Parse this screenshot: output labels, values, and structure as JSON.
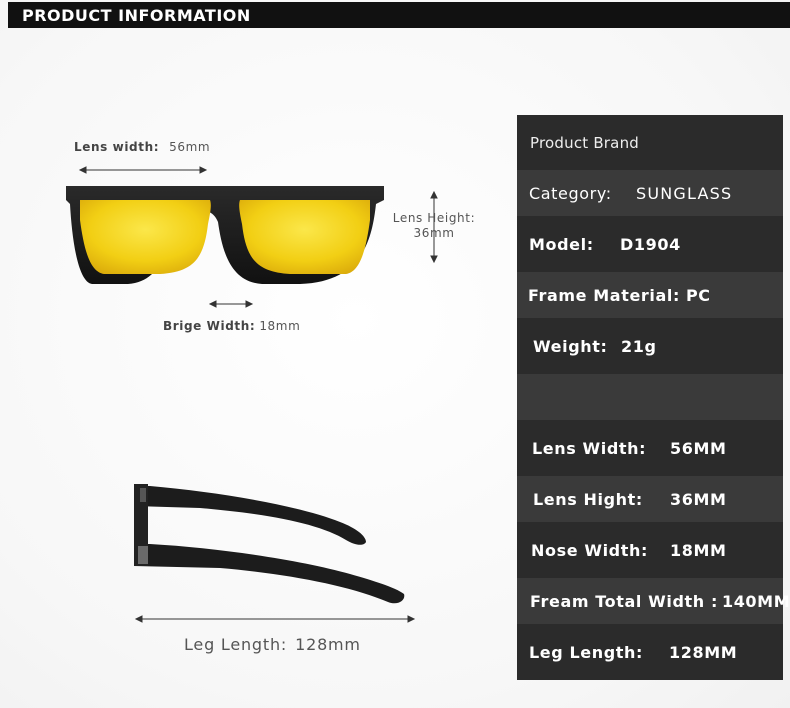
{
  "header": {
    "title": "PRODUCT INFORMATION"
  },
  "dimensions": {
    "lens_width": {
      "label": "Lens width:",
      "value": "56mm"
    },
    "lens_height": {
      "label": "Lens Height:",
      "value": "36mm"
    },
    "bridge_width": {
      "label": "Brige Width:",
      "value": "18mm"
    },
    "leg_length": {
      "label": "Leg Length:",
      "value": "128mm"
    }
  },
  "specs": [
    {
      "key": "Product Brand",
      "value": ""
    },
    {
      "key": "Category:",
      "value": "SUNGLASS"
    },
    {
      "key": "Model:",
      "value": "D1904"
    },
    {
      "key": "Frame Material:",
      "value": "PC"
    },
    {
      "key": "Weight:",
      "value": "21g"
    },
    {
      "key": "",
      "value": ""
    },
    {
      "key": "Lens Width:",
      "value": "56MM"
    },
    {
      "key": "Lens Hight:",
      "value": "36MM"
    },
    {
      "key": "Nose Width:",
      "value": "18MM"
    },
    {
      "key": "Fream Total Width :",
      "value": "140MM"
    },
    {
      "key": "Leg Length:",
      "value": "128MM"
    }
  ],
  "colors": {
    "panel_dark": "#2b2b2b",
    "panel_mid": "#3a3a3a",
    "lens": "#f2d020",
    "frame": "#1a1a1a"
  }
}
